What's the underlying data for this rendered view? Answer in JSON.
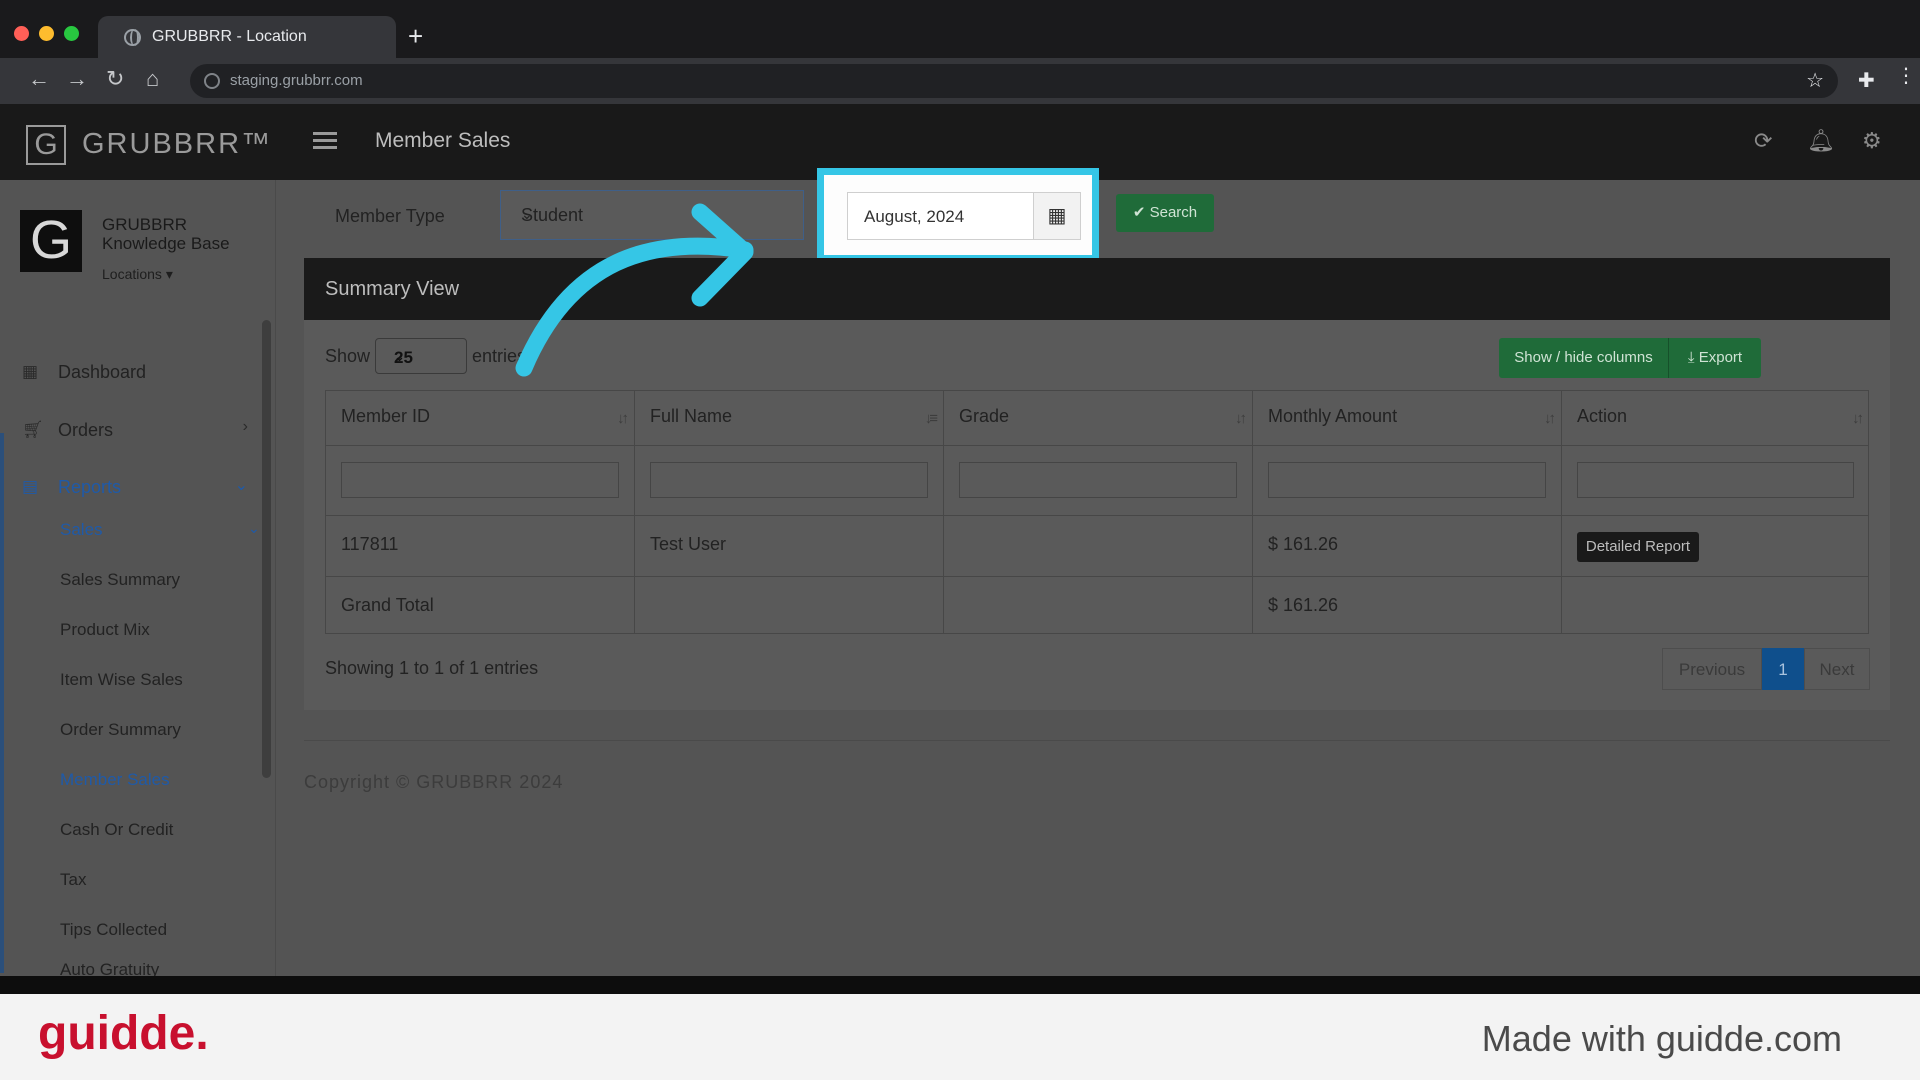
{
  "browser": {
    "tab_title": "GRUBBRR - Location",
    "url": "staging.grubbrr.com"
  },
  "app": {
    "brand": "GRUBBRR™",
    "page_title": "Member Sales",
    "org": {
      "name": "GRUBBRR Knowledge Base",
      "locations_label": "Locations ▾"
    }
  },
  "sidebar": {
    "items": [
      {
        "label": "Dashboard",
        "icon": "dashboard-icon"
      },
      {
        "label": "Orders",
        "icon": "cart-icon"
      },
      {
        "label": "Reports",
        "icon": "document-icon"
      }
    ],
    "sales_label": "Sales",
    "sub_items": [
      "Sales Summary",
      "Product Mix",
      "Item Wise Sales",
      "Order Summary",
      "Member Sales",
      "Cash Or Credit",
      "Tax",
      "Tips Collected",
      "Auto Gratuity"
    ]
  },
  "filters": {
    "member_type_label": "Member Type",
    "member_type_value": "Student",
    "date_value": "August, 2024",
    "search_label": "✔ Search"
  },
  "summary": {
    "title": "Summary View",
    "show_label": "Show",
    "page_size": "25",
    "entries_label": "entries",
    "showhide_label": "Show / hide columns",
    "export_label": "⤓ Export",
    "columns": [
      "Member ID",
      "Full Name",
      "Grade",
      "Monthly Amount",
      "Action"
    ],
    "rows": [
      {
        "member_id": "117811",
        "full_name": "Test User",
        "grade": "",
        "monthly_amount": "$ 161.26",
        "action": "Detailed Report"
      }
    ],
    "grand_total": {
      "label": "Grand Total",
      "monthly_amount": "$ 161.26"
    },
    "showing_text": "Showing 1 to 1 of 1 entries",
    "pager": {
      "previous": "Previous",
      "current": "1",
      "next": "Next"
    }
  },
  "footer": {
    "copyright": "Copyright © GRUBBRR 2024"
  },
  "guidde": {
    "logo": "guidde.",
    "made_with": "Made with guidde.com"
  },
  "colors": {
    "highlight": "#35c6e6",
    "accent_green": "#1f6b39",
    "link_blue": "#1f5aa8"
  }
}
